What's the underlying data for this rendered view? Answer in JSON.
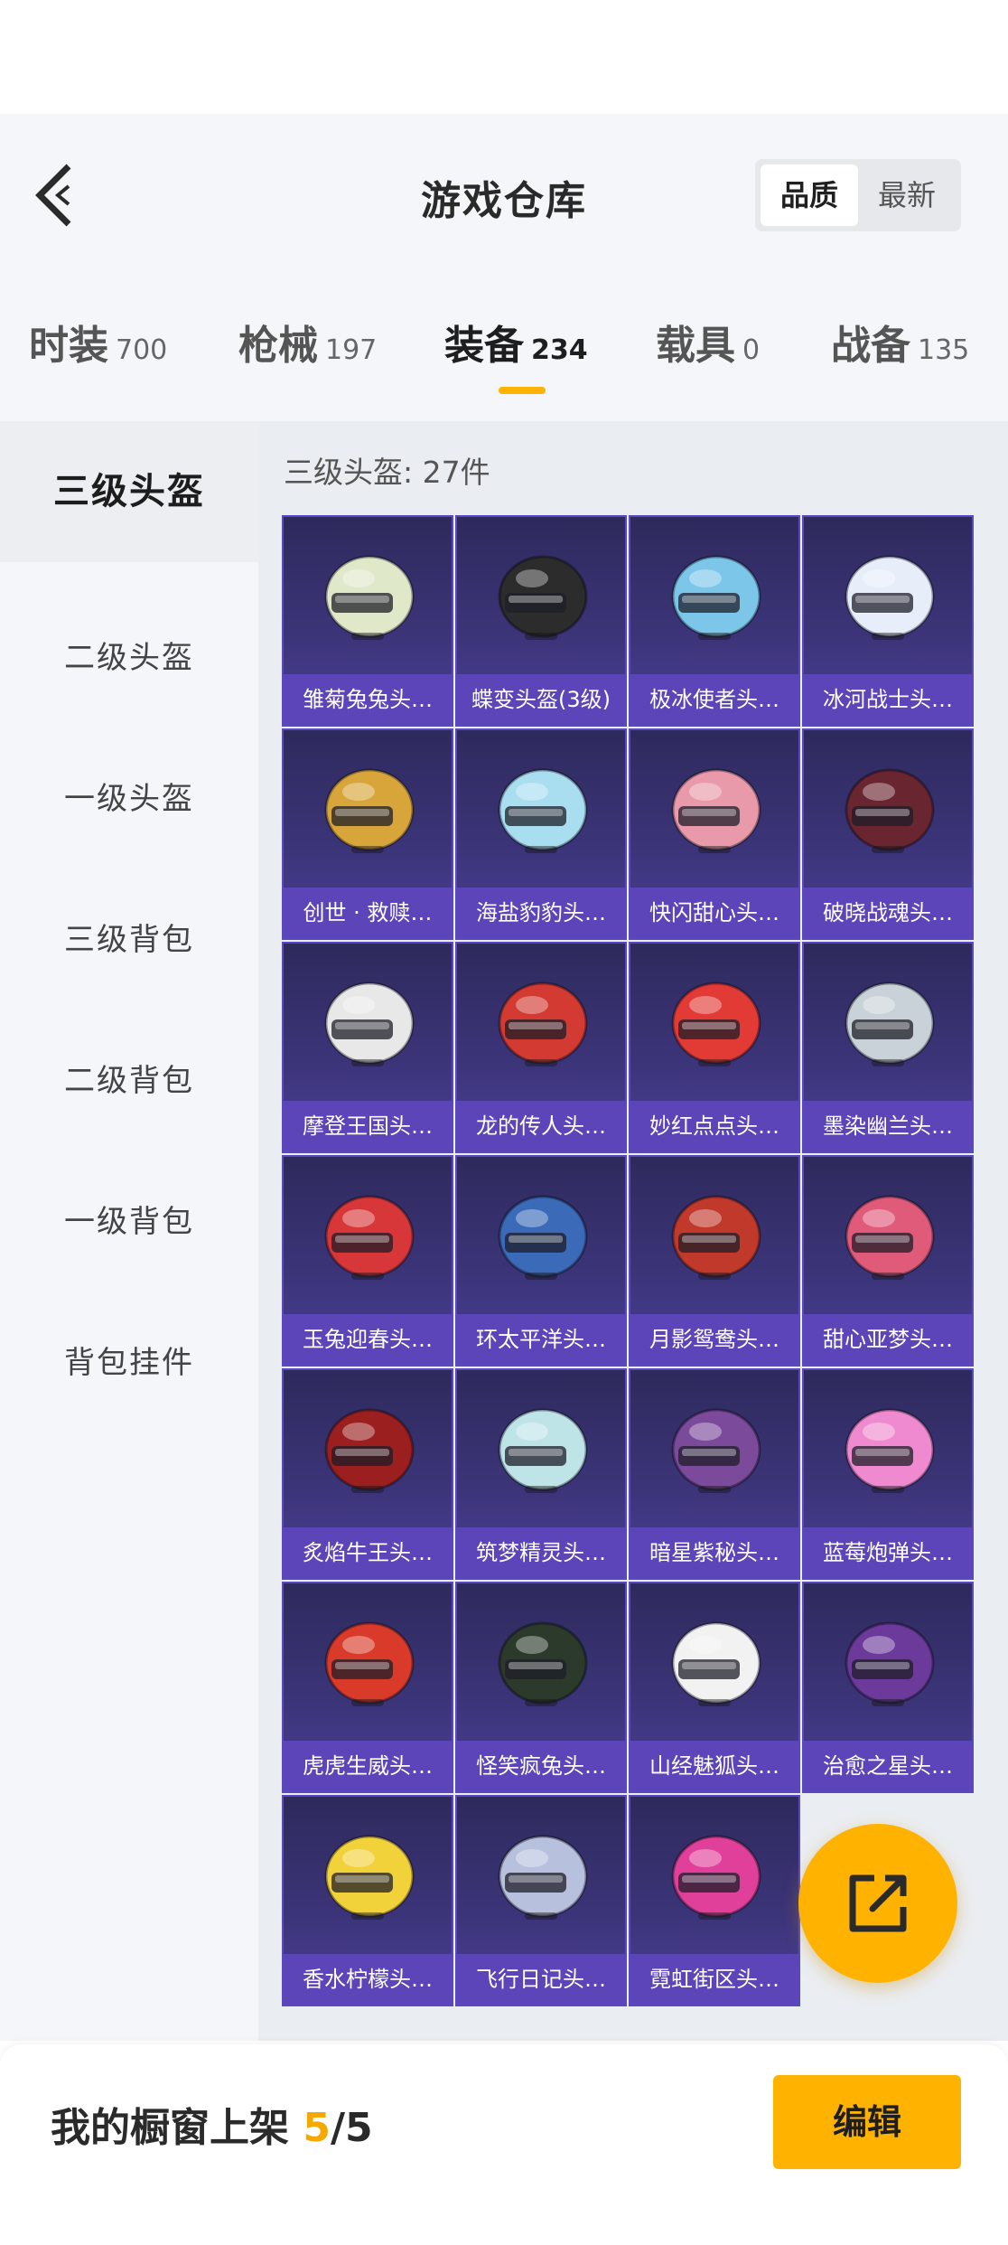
{
  "header": {
    "title": "游戏仓库",
    "back_icon": "back-chevron-icon"
  },
  "sort": {
    "options": [
      "品质",
      "最新"
    ],
    "selected": "品质"
  },
  "tabs": [
    {
      "label": "时装",
      "count": "700"
    },
    {
      "label": "枪械",
      "count": "197"
    },
    {
      "label": "装备",
      "count": "234",
      "active": true
    },
    {
      "label": "载具",
      "count": "0"
    },
    {
      "label": "战备",
      "count": "135"
    }
  ],
  "sidebar": {
    "items": [
      "三级头盔",
      "二级头盔",
      "一级头盔",
      "三级背包",
      "二级背包",
      "一级背包",
      "背包挂件"
    ],
    "selected": "三级头盔"
  },
  "content": {
    "count_label": "三级头盔: 27件"
  },
  "items": [
    {
      "name": "雏菊兔兔头…",
      "color": "#dfe8c8"
    },
    {
      "name": "蝶变头盔(3级)",
      "color": "#2c2c2c"
    },
    {
      "name": "极冰使者头…",
      "color": "#7cc6ea"
    },
    {
      "name": "冰河战士头…",
      "color": "#e7eefa"
    },
    {
      "name": "创世 · 救赎…",
      "color": "#d8a53a"
    },
    {
      "name": "海盐豹豹头…",
      "color": "#a9ddf0"
    },
    {
      "name": "快闪甜心头…",
      "color": "#e89aaa"
    },
    {
      "name": "破晓战魂头…",
      "color": "#6a2630"
    },
    {
      "name": "摩登王国头…",
      "color": "#e8e8e8"
    },
    {
      "name": "龙的传人头…",
      "color": "#d23a32"
    },
    {
      "name": "妙红点点头…",
      "color": "#e23a35"
    },
    {
      "name": "墨染幽兰头…",
      "color": "#c8d2d8"
    },
    {
      "name": "玉兔迎春头…",
      "color": "#d8373a"
    },
    {
      "name": "环太平洋头…",
      "color": "#3a6ab8"
    },
    {
      "name": "月影鸳鸯头…",
      "color": "#c0392b"
    },
    {
      "name": "甜心亚梦头…",
      "color": "#e05a7a"
    },
    {
      "name": "炙焰牛王头…",
      "color": "#9b1f1f"
    },
    {
      "name": "筑梦精灵头…",
      "color": "#bfe4e8"
    },
    {
      "name": "暗星紫秘头…",
      "color": "#7b4a9a"
    },
    {
      "name": "蓝莓炮弹头…",
      "color": "#f08ad0"
    },
    {
      "name": "虎虎生威头…",
      "color": "#d93a2a"
    },
    {
      "name": "怪笑疯兔头…",
      "color": "#2c3a2c"
    },
    {
      "name": "山经魅狐头…",
      "color": "#f2f2f2"
    },
    {
      "name": "治愈之星头…",
      "color": "#6b3a9a"
    },
    {
      "name": "香水柠檬头…",
      "color": "#f2d23a"
    },
    {
      "name": "飞行日记头…",
      "color": "#b7c0dd"
    },
    {
      "name": "霓虹街区头…",
      "color": "#e0409a"
    }
  ],
  "fab": {
    "icon": "share-external-icon"
  },
  "bottom": {
    "label": "我的橱窗上架",
    "current": "5",
    "total": "/5",
    "edit_label": "编辑"
  }
}
